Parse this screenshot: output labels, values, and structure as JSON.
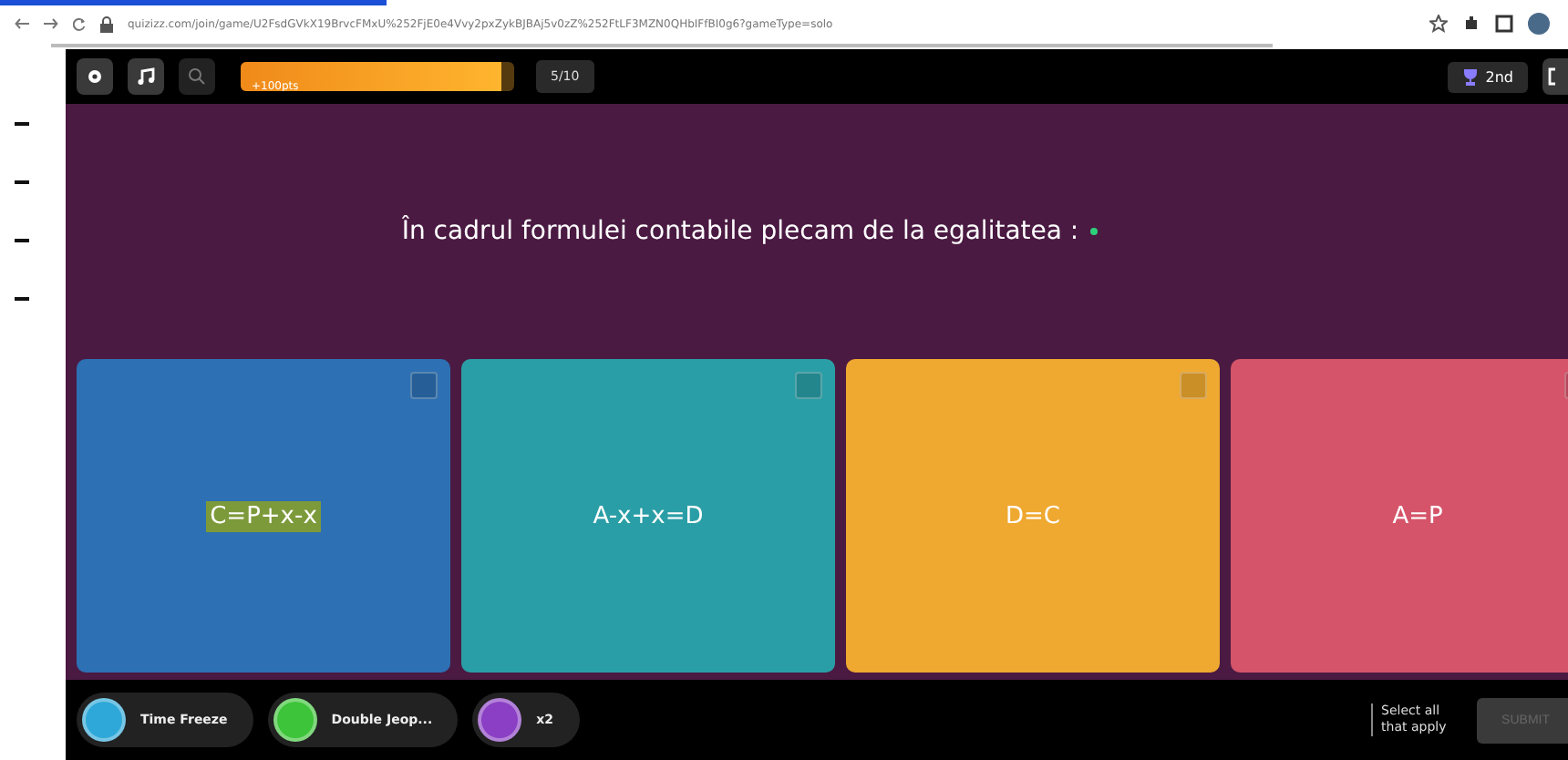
{
  "browser": {
    "url": "quizizz.com/join/game/U2FsdGVkX19BrvcFMxU%252FjE0e4Vvy2pxZykBJBAj5v0zZ%252FtLF3MZN0QHbIFfBI0g6?gameType=solo"
  },
  "topbar": {
    "streak": {
      "text": "+100pts",
      "level": 0.95
    },
    "question_count": "5/10",
    "rank": "2nd"
  },
  "question": {
    "text": "În cadrul formulei contabile plecam de la egalitatea :"
  },
  "answers": [
    {
      "text": "C=P+x-x",
      "color": "#2d70b3",
      "selected": true
    },
    {
      "text": "A-x+x=D",
      "color": "#2a9ea6",
      "selected": false
    },
    {
      "text": "D=C",
      "color": "#efa830",
      "selected": false
    },
    {
      "text": "A=P",
      "color": "#d5546a",
      "selected": false
    }
  ],
  "powerups": [
    {
      "label": "Time Freeze",
      "color": "#2ea8d8"
    },
    {
      "label": "Double Jeop...",
      "color": "#3ec43a"
    },
    {
      "label": "x2",
      "color": "#8a3fc4"
    }
  ],
  "footer": {
    "hint": "Select all that apply",
    "submit": "SUBMIT",
    "submit_disabled": true
  }
}
